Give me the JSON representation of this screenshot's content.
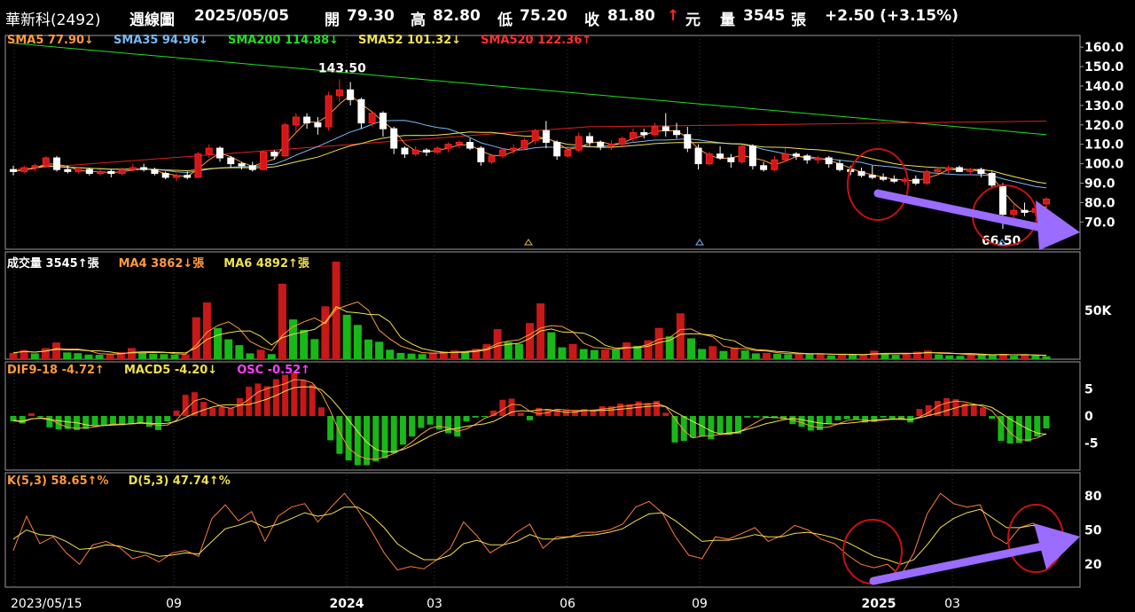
{
  "header": {
    "stock": "華新科(2492)",
    "period": "週線圖",
    "date": "2025/05/05",
    "open_label": "開",
    "open": "79.30",
    "high_label": "高",
    "high": "82.80",
    "low_label": "低",
    "low": "75.20",
    "close_label": "收",
    "close": "81.80",
    "close_arrow": "↑",
    "currency": "元",
    "vol_label": "量",
    "volume": "3545",
    "vol_unit": "張",
    "change": "+2.50 (+3.15%)"
  },
  "legends": {
    "price": [
      {
        "text": "SMA5 77.90↓",
        "color": "#ff9a3c"
      },
      {
        "text": "SMA35 94.96↓",
        "color": "#7ab8f5"
      },
      {
        "text": "SMA200 114.88↓",
        "color": "#22dd22"
      },
      {
        "text": "SMA52 101.32↓",
        "color": "#f0e050"
      },
      {
        "text": "SMA520 122.36↑",
        "color": "#ff3030"
      }
    ],
    "volume": [
      {
        "text": "成交量 3545↑張",
        "color": "#ffffff"
      },
      {
        "text": "MA4 3862↓張",
        "color": "#ff9a3c"
      },
      {
        "text": "MA6 4892↑張",
        "color": "#f0e050"
      }
    ],
    "macd": [
      {
        "text": "DIF9-18 -4.72↑",
        "color": "#ff9a3c"
      },
      {
        "text": "MACD5 -4.20↓",
        "color": "#f0e050"
      },
      {
        "text": "OSC -0.52↑",
        "color": "#ff40ff"
      }
    ],
    "kd": [
      {
        "text": "K(5,3) 58.65↑%",
        "color": "#ff9a3c"
      },
      {
        "text": "D(5,3) 47.74↑%",
        "color": "#f0e050"
      }
    ]
  },
  "chart_data": {
    "type": "candlestick",
    "x_labels": [
      "2023/05/15",
      "09",
      "2024",
      "03",
      "06",
      "09",
      "2025",
      "03"
    ],
    "price_axis": {
      "ticks": [
        "160.0",
        "150.0",
        "140.0",
        "130.0",
        "120.0",
        "110.0",
        "100.0",
        "90.0",
        "80.0",
        "70.0"
      ],
      "range": [
        56,
        166
      ]
    },
    "volume_axis": {
      "ticks": [
        "50K"
      ]
    },
    "macd_axis": {
      "ticks": [
        "5",
        "0",
        "-5"
      ],
      "range": [
        -10,
        10
      ]
    },
    "kd_axis": {
      "ticks": [
        "80",
        "50",
        "20"
      ],
      "range": [
        0,
        100
      ]
    },
    "annotations": {
      "high": "143.50",
      "low": "66.50"
    },
    "candles": [
      [
        97,
        99,
        94,
        96
      ],
      [
        96,
        99,
        95,
        98
      ],
      [
        98,
        100,
        96,
        99
      ],
      [
        99,
        104,
        98,
        103
      ],
      [
        103,
        104,
        96,
        97
      ],
      [
        97,
        99,
        95,
        96
      ],
      [
        96,
        98,
        95,
        97
      ],
      [
        97,
        98,
        94,
        95
      ],
      [
        95,
        97,
        94,
        96
      ],
      [
        96,
        97,
        93,
        95
      ],
      [
        95,
        98,
        94,
        97
      ],
      [
        97,
        100,
        96,
        98
      ],
      [
        98,
        100,
        96,
        97
      ],
      [
        97,
        98,
        94,
        95
      ],
      [
        95,
        96,
        92,
        93
      ],
      [
        93,
        95,
        91,
        94
      ],
      [
        94,
        96,
        92,
        93
      ],
      [
        93,
        106,
        93,
        105
      ],
      [
        105,
        110,
        103,
        108
      ],
      [
        108,
        109,
        101,
        103
      ],
      [
        103,
        104,
        98,
        100
      ],
      [
        100,
        101,
        97,
        99
      ],
      [
        99,
        101,
        96,
        97
      ],
      [
        97,
        107,
        97,
        106
      ],
      [
        106,
        107,
        102,
        104
      ],
      [
        104,
        121,
        104,
        120
      ],
      [
        120,
        126,
        116,
        124
      ],
      [
        124,
        126,
        118,
        121
      ],
      [
        121,
        124,
        115,
        119
      ],
      [
        119,
        137,
        117,
        135
      ],
      [
        135,
        143.5,
        132,
        138
      ],
      [
        138,
        142,
        130,
        133
      ],
      [
        133,
        134,
        118,
        121
      ],
      [
        121,
        127,
        119,
        126
      ],
      [
        126,
        127,
        114,
        118
      ],
      [
        118,
        119,
        105,
        108
      ],
      [
        108,
        109,
        103,
        105
      ],
      [
        105,
        109,
        104,
        107
      ],
      [
        107,
        108,
        104,
        106
      ],
      [
        106,
        109,
        105,
        108
      ],
      [
        108,
        111,
        106,
        110
      ],
      [
        110,
        112,
        108,
        111
      ],
      [
        111,
        113,
        107,
        108
      ],
      [
        108,
        109,
        99,
        101
      ],
      [
        101,
        105,
        100,
        104
      ],
      [
        104,
        108,
        103,
        107
      ],
      [
        107,
        110,
        105,
        108
      ],
      [
        108,
        113,
        107,
        112
      ],
      [
        112,
        118,
        110,
        117
      ],
      [
        117,
        122,
        108,
        111
      ],
      [
        111,
        112,
        102,
        104
      ],
      [
        104,
        108,
        103,
        107
      ],
      [
        107,
        116,
        106,
        114
      ],
      [
        114,
        116,
        109,
        111
      ],
      [
        111,
        112,
        107,
        109
      ],
      [
        109,
        112,
        107,
        110
      ],
      [
        110,
        114,
        109,
        113
      ],
      [
        113,
        118,
        111,
        116
      ],
      [
        116,
        118,
        113,
        115
      ],
      [
        115,
        121,
        114,
        119
      ],
      [
        119,
        126,
        114,
        117
      ],
      [
        117,
        121,
        113,
        115
      ],
      [
        115,
        119,
        106,
        108
      ],
      [
        108,
        110,
        97,
        100
      ],
      [
        100,
        106,
        99,
        105
      ],
      [
        105,
        109,
        102,
        103
      ],
      [
        103,
        105,
        98,
        101
      ],
      [
        101,
        110,
        100,
        109
      ],
      [
        109,
        110,
        97,
        99
      ],
      [
        99,
        101,
        96,
        97
      ],
      [
        97,
        104,
        96,
        102
      ],
      [
        102,
        108,
        101,
        105
      ],
      [
        105,
        106,
        102,
        104
      ],
      [
        104,
        105,
        100,
        102
      ],
      [
        102,
        104,
        100,
        103
      ],
      [
        103,
        104,
        98,
        100
      ],
      [
        100,
        102,
        96,
        97
      ],
      [
        97,
        99,
        94,
        96
      ],
      [
        96,
        98,
        93,
        94
      ],
      [
        94,
        99,
        92,
        93
      ],
      [
        93,
        95,
        91,
        92
      ],
      [
        92,
        94,
        90,
        91
      ],
      [
        91,
        93,
        89,
        92
      ],
      [
        92,
        94,
        89,
        90
      ],
      [
        90,
        97,
        89,
        96
      ],
      [
        96,
        98,
        94,
        97
      ],
      [
        97,
        99,
        95,
        98
      ],
      [
        98,
        99,
        96,
        96
      ],
      [
        96,
        98,
        94,
        97
      ],
      [
        97,
        98,
        93,
        95
      ],
      [
        95,
        96,
        88,
        89
      ],
      [
        89,
        90,
        66.5,
        74
      ],
      [
        74,
        79,
        72,
        76
      ],
      [
        76,
        80,
        73,
        75
      ],
      [
        75,
        79,
        73,
        77
      ],
      [
        79.3,
        82.8,
        75.2,
        81.8
      ]
    ],
    "volume": [
      2.6,
      3.8,
      2.4,
      4.6,
      6.9,
      2.8,
      2.5,
      1.9,
      1.8,
      2.1,
      2.9,
      4.6,
      2.8,
      2.2,
      2.1,
      1.9,
      2.0,
      17.3,
      23.4,
      12.8,
      8.2,
      5.8,
      2.4,
      3.9,
      2.1,
      31.1,
      16.4,
      12.1,
      8.3,
      21.8,
      40.2,
      18.3,
      14.1,
      8.1,
      7.2,
      3.9,
      2.6,
      2.3,
      2.1,
      2.8,
      3.2,
      3.6,
      3.1,
      4.3,
      6.2,
      12.4,
      7.1,
      6.3,
      14.9,
      23.0,
      11.1,
      4.9,
      6.3,
      4.2,
      3.8,
      4.0,
      3.9,
      6.9,
      5.5,
      7.8,
      12.9,
      9.4,
      18.9,
      8.6,
      4.2,
      5.4,
      3.4,
      4.8,
      3.6,
      2.4,
      2.6,
      2.2,
      2.0,
      2.4,
      2.1,
      2.2,
      1.6,
      2.0,
      1.7,
      2.0,
      3.5,
      2.4,
      1.8,
      2.2,
      3.1,
      3.6,
      2.0,
      1.6,
      1.4,
      2.4,
      1.8,
      1.7,
      2.2,
      1.4,
      1.9,
      1.5,
      1.2
    ],
    "osc": [
      -1.0,
      -1.4,
      0.5,
      -0.2,
      -2.1,
      -2.5,
      -2.4,
      -2.6,
      -2.4,
      -1.7,
      -1.7,
      -1.7,
      -1.7,
      -1.5,
      -1.3,
      -2.0,
      -2.6,
      -1.0,
      1.0,
      3.9,
      4.4,
      2.6,
      1.5,
      1.7,
      1.5,
      3.3,
      5.4,
      6.0,
      5.5,
      6.8,
      7.6,
      8.0,
      6.6,
      5.8,
      1.6,
      -4.5,
      -7.0,
      -8.2,
      -9.1,
      -9.1,
      -8.4,
      -7.8,
      -6.9,
      -5.3,
      -3.8,
      -2.2,
      -1.6,
      -2.5,
      -3.2,
      -3.8,
      -1.0,
      -0.3,
      -0.2,
      1.0,
      3.0,
      3.2,
      0.6,
      -0.8,
      1.5,
      1.3,
      1.3,
      1.1,
      1.0,
      1.3,
      1.2,
      1.8,
      1.8,
      2.3,
      2.2,
      2.7,
      2.4,
      2.8,
      0.6,
      -4.9,
      -4.6,
      -4.0,
      -3.8,
      -4.3,
      -3.3,
      -3.5,
      -3.3,
      -0.3,
      -0.3,
      -0.3,
      -0.4,
      -0.6,
      -1.5,
      -2.0,
      -2.7,
      -2.6,
      -1.5,
      -0.8,
      -0.6,
      -0.7,
      -1.2,
      -1.1,
      -0.3,
      -0.5,
      -0.7,
      -1.2,
      1.3,
      2.0,
      2.8,
      3.3,
      3.1,
      2.3,
      2.0,
      1.6,
      -0.5,
      -4.6,
      -5.1,
      -5.0,
      -4.7,
      -3.8,
      -2.3
    ],
    "kd_k": [
      32,
      62,
      38,
      44,
      30,
      20,
      37,
      40,
      35,
      25,
      28,
      22,
      30,
      32,
      27,
      60,
      72,
      58,
      66,
      40,
      62,
      70,
      73,
      57,
      70,
      82,
      68,
      50,
      30,
      15,
      18,
      16,
      24,
      34,
      57,
      45,
      30,
      37,
      48,
      55,
      34,
      44,
      44,
      48,
      48,
      50,
      55,
      70,
      75,
      65,
      44,
      28,
      25,
      44,
      42,
      47,
      52,
      40,
      45,
      54,
      50,
      42,
      38,
      28,
      20,
      17,
      20,
      10,
      30,
      64,
      82,
      73,
      70,
      72,
      45,
      38,
      52,
      56,
      42
    ],
    "kd_d": [
      42,
      50,
      46,
      45,
      40,
      33,
      34,
      37,
      36,
      32,
      30,
      27,
      28,
      30,
      29,
      40,
      51,
      54,
      58,
      52,
      55,
      60,
      65,
      62,
      64,
      70,
      70,
      63,
      52,
      38,
      30,
      24,
      24,
      28,
      38,
      41,
      37,
      37,
      40,
      46,
      42,
      42,
      44,
      45,
      46,
      48,
      51,
      58,
      64,
      65,
      58,
      49,
      40,
      41,
      41,
      43,
      46,
      44,
      44,
      47,
      48,
      46,
      43,
      39,
      33,
      27,
      24,
      20,
      24,
      37,
      52,
      60,
      65,
      68,
      60,
      52,
      52,
      54,
      50
    ]
  }
}
